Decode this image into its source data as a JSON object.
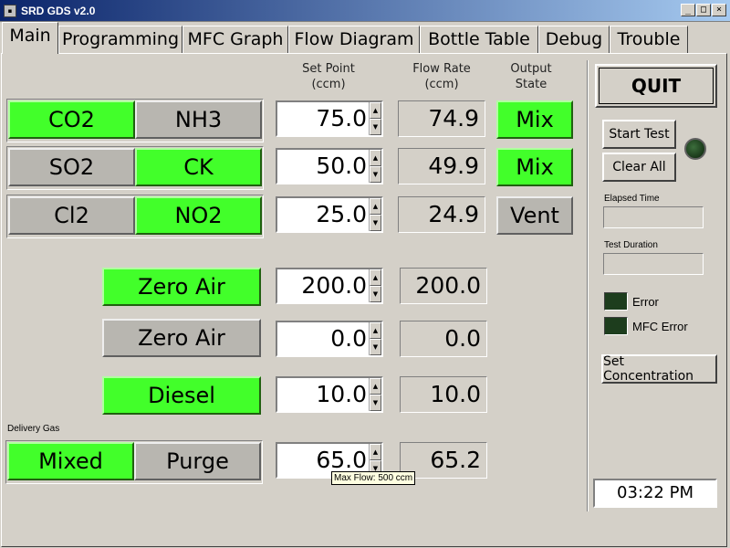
{
  "window": {
    "title": "SRD GDS v2.0",
    "min": "_",
    "max": "□",
    "close": "×"
  },
  "tabs": [
    "Main",
    "Programming",
    "MFC Graph",
    "Flow Diagram",
    "Bottle Table",
    "Debug",
    "Trouble"
  ],
  "headers": {
    "set_point": "Set Point",
    "set_point_unit": "(ccm)",
    "flow_rate": "Flow Rate",
    "flow_rate_unit": "(ccm)",
    "output": "Output",
    "output_state": "State"
  },
  "gas_rows": [
    {
      "left": "CO2",
      "left_on": true,
      "right": "NH3",
      "right_on": false,
      "set": "75.0",
      "flow": "74.9",
      "output": "Mix",
      "output_on": true
    },
    {
      "left": "SO2",
      "left_on": false,
      "right": "CK",
      "right_on": true,
      "set": "50.0",
      "flow": "49.9",
      "output": "Mix",
      "output_on": true
    },
    {
      "left": "Cl2",
      "left_on": false,
      "right": "NO2",
      "right_on": true,
      "set": "25.0",
      "flow": "24.9",
      "output": "Vent",
      "output_on": false
    }
  ],
  "single_rows": [
    {
      "label": "Zero Air",
      "on": true,
      "set": "200.0",
      "flow": "200.0"
    },
    {
      "label": "Zero Air",
      "on": false,
      "set": "0.0",
      "flow": "0.0"
    },
    {
      "label": "Diesel",
      "on": true,
      "set": "10.0",
      "flow": "10.0"
    }
  ],
  "delivery": {
    "label": "Delivery Gas",
    "mixed": "Mixed",
    "purge": "Purge",
    "set": "65.0",
    "flow": "65.2",
    "tooltip": "Max Flow: 500 ccm"
  },
  "right_panel": {
    "quit": "QUIT",
    "start_test": "Start Test",
    "clear_all": "Clear All",
    "elapsed_time": "Elapsed Time",
    "test_duration": "Test Duration",
    "error": "Error",
    "mfc_error": "MFC Error",
    "set_concentration": "Set Concentration",
    "clock": "03:22 PM"
  },
  "colors": {
    "on": "#42ff2a",
    "off": "#b8b6b0",
    "background": "#d4d0c8"
  }
}
